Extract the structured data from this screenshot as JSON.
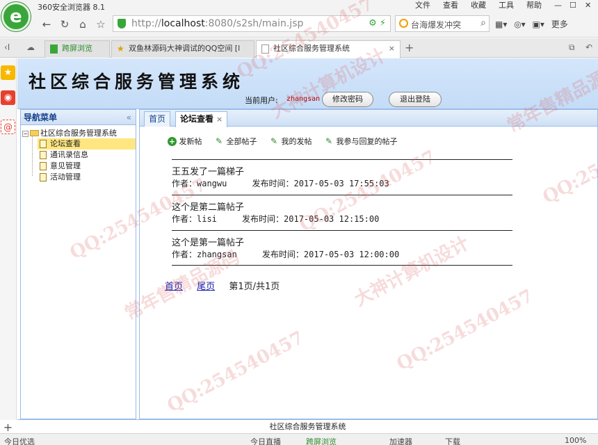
{
  "browser": {
    "app_title": "360安全浏览器 8.1",
    "menu": [
      "文件",
      "查看",
      "收藏",
      "工具",
      "帮助"
    ],
    "url_prefix": "http://",
    "url_host": "localhost",
    "url_rest": ":8080/s2sh/main.jsp",
    "search_text": "台海爆发冲突",
    "right_tools_more": "更多",
    "tabs": [
      {
        "label": "跨屏浏览",
        "icon": "phone-icon"
      },
      {
        "label": "双鱼林源码大神调试的QQ空间 [l",
        "icon": "star-icon"
      },
      {
        "label": "社区综合服务管理系统",
        "icon": "page-icon"
      }
    ],
    "status_items": [
      "今日优选",
      "今日直播",
      "跨屏浏览",
      "加速器",
      "下载",
      "100%"
    ]
  },
  "header": {
    "title": "社区综合服务管理系统",
    "user_label": "当前用户:",
    "user_name": "zhangsan",
    "change_pwd": "修改密码",
    "logout": "退出登陆"
  },
  "nav": {
    "title": "导航菜单",
    "collapse": "«",
    "root": "社区综合服务管理系统",
    "items": [
      {
        "label": "论坛查看",
        "selected": true
      },
      {
        "label": "通讯录信息",
        "selected": false
      },
      {
        "label": "意见管理",
        "selected": false
      },
      {
        "label": "活动管理",
        "selected": false
      }
    ]
  },
  "content": {
    "tabs": [
      {
        "label": "首页",
        "closable": false
      },
      {
        "label": "论坛查看",
        "closable": true
      }
    ],
    "toolbar": [
      "发新帖",
      "全部帖子",
      "我的发帖",
      "我参与回复的帖子"
    ],
    "posts": [
      {
        "title": "王五发了一篇梯子",
        "meta": "作者：wangwu     发布时间：2017-05-03 17:55:03"
      },
      {
        "title": "这个是第二篇帖子",
        "meta": "作者：lisi     发布时间：2017-05-03 12:15:00"
      },
      {
        "title": "这个是第一篇帖子",
        "meta": "作者：zhangsan     发布时间：2017-05-03 12:00:00"
      }
    ],
    "pager": {
      "first": "首页",
      "last": "尾页",
      "info": "第1页/共1页"
    }
  },
  "footer": {
    "text": "社区综合服务管理系统"
  },
  "watermarks": [
    "QQ:254540457",
    "大神计算机设计",
    "常年售精品源码"
  ]
}
